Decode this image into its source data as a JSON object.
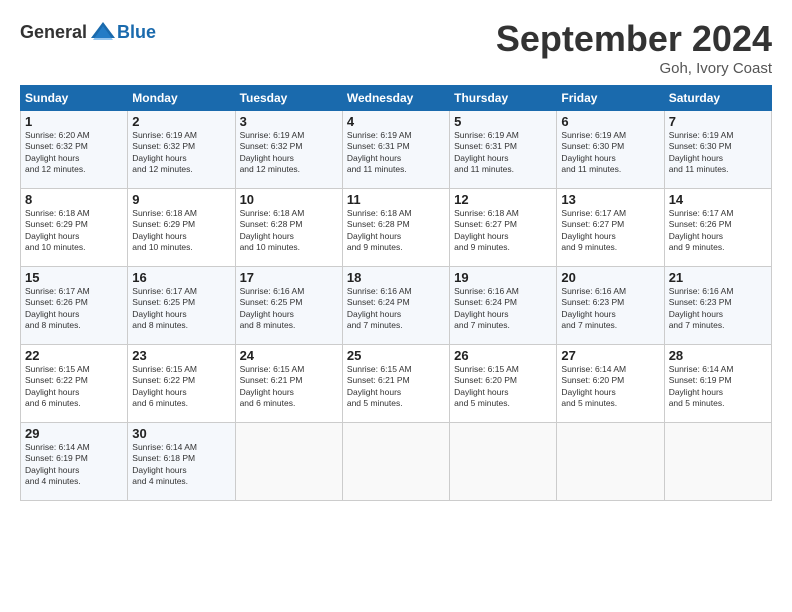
{
  "logo": {
    "general": "General",
    "blue": "Blue"
  },
  "header": {
    "month": "September 2024",
    "location": "Goh, Ivory Coast"
  },
  "weekdays": [
    "Sunday",
    "Monday",
    "Tuesday",
    "Wednesday",
    "Thursday",
    "Friday",
    "Saturday"
  ],
  "weeks": [
    [
      {
        "day": "1",
        "sunrise": "6:20 AM",
        "sunset": "6:32 PM",
        "daylight": "12 hours and 12 minutes."
      },
      {
        "day": "2",
        "sunrise": "6:19 AM",
        "sunset": "6:32 PM",
        "daylight": "12 hours and 12 minutes."
      },
      {
        "day": "3",
        "sunrise": "6:19 AM",
        "sunset": "6:32 PM",
        "daylight": "12 hours and 12 minutes."
      },
      {
        "day": "4",
        "sunrise": "6:19 AM",
        "sunset": "6:31 PM",
        "daylight": "12 hours and 11 minutes."
      },
      {
        "day": "5",
        "sunrise": "6:19 AM",
        "sunset": "6:31 PM",
        "daylight": "12 hours and 11 minutes."
      },
      {
        "day": "6",
        "sunrise": "6:19 AM",
        "sunset": "6:30 PM",
        "daylight": "12 hours and 11 minutes."
      },
      {
        "day": "7",
        "sunrise": "6:19 AM",
        "sunset": "6:30 PM",
        "daylight": "12 hours and 11 minutes."
      }
    ],
    [
      {
        "day": "8",
        "sunrise": "6:18 AM",
        "sunset": "6:29 PM",
        "daylight": "12 hours and 10 minutes."
      },
      {
        "day": "9",
        "sunrise": "6:18 AM",
        "sunset": "6:29 PM",
        "daylight": "12 hours and 10 minutes."
      },
      {
        "day": "10",
        "sunrise": "6:18 AM",
        "sunset": "6:28 PM",
        "daylight": "12 hours and 10 minutes."
      },
      {
        "day": "11",
        "sunrise": "6:18 AM",
        "sunset": "6:28 PM",
        "daylight": "12 hours and 9 minutes."
      },
      {
        "day": "12",
        "sunrise": "6:18 AM",
        "sunset": "6:27 PM",
        "daylight": "12 hours and 9 minutes."
      },
      {
        "day": "13",
        "sunrise": "6:17 AM",
        "sunset": "6:27 PM",
        "daylight": "12 hours and 9 minutes."
      },
      {
        "day": "14",
        "sunrise": "6:17 AM",
        "sunset": "6:26 PM",
        "daylight": "12 hours and 9 minutes."
      }
    ],
    [
      {
        "day": "15",
        "sunrise": "6:17 AM",
        "sunset": "6:26 PM",
        "daylight": "12 hours and 8 minutes."
      },
      {
        "day": "16",
        "sunrise": "6:17 AM",
        "sunset": "6:25 PM",
        "daylight": "12 hours and 8 minutes."
      },
      {
        "day": "17",
        "sunrise": "6:16 AM",
        "sunset": "6:25 PM",
        "daylight": "12 hours and 8 minutes."
      },
      {
        "day": "18",
        "sunrise": "6:16 AM",
        "sunset": "6:24 PM",
        "daylight": "12 hours and 7 minutes."
      },
      {
        "day": "19",
        "sunrise": "6:16 AM",
        "sunset": "6:24 PM",
        "daylight": "12 hours and 7 minutes."
      },
      {
        "day": "20",
        "sunrise": "6:16 AM",
        "sunset": "6:23 PM",
        "daylight": "12 hours and 7 minutes."
      },
      {
        "day": "21",
        "sunrise": "6:16 AM",
        "sunset": "6:23 PM",
        "daylight": "12 hours and 7 minutes."
      }
    ],
    [
      {
        "day": "22",
        "sunrise": "6:15 AM",
        "sunset": "6:22 PM",
        "daylight": "12 hours and 6 minutes."
      },
      {
        "day": "23",
        "sunrise": "6:15 AM",
        "sunset": "6:22 PM",
        "daylight": "12 hours and 6 minutes."
      },
      {
        "day": "24",
        "sunrise": "6:15 AM",
        "sunset": "6:21 PM",
        "daylight": "12 hours and 6 minutes."
      },
      {
        "day": "25",
        "sunrise": "6:15 AM",
        "sunset": "6:21 PM",
        "daylight": "12 hours and 5 minutes."
      },
      {
        "day": "26",
        "sunrise": "6:15 AM",
        "sunset": "6:20 PM",
        "daylight": "12 hours and 5 minutes."
      },
      {
        "day": "27",
        "sunrise": "6:14 AM",
        "sunset": "6:20 PM",
        "daylight": "12 hours and 5 minutes."
      },
      {
        "day": "28",
        "sunrise": "6:14 AM",
        "sunset": "6:19 PM",
        "daylight": "12 hours and 5 minutes."
      }
    ],
    [
      {
        "day": "29",
        "sunrise": "6:14 AM",
        "sunset": "6:19 PM",
        "daylight": "12 hours and 4 minutes."
      },
      {
        "day": "30",
        "sunrise": "6:14 AM",
        "sunset": "6:18 PM",
        "daylight": "12 hours and 4 minutes."
      },
      null,
      null,
      null,
      null,
      null
    ]
  ]
}
